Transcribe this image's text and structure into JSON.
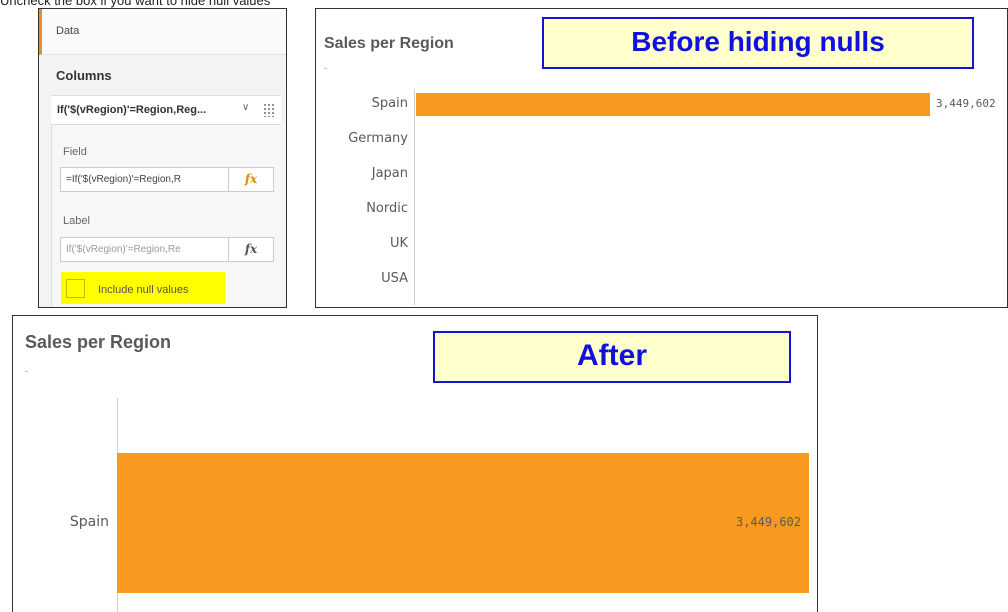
{
  "caption": "Uncheck the box if you want to hide null values",
  "panel": {
    "data_tab": "Data",
    "columns_title": "Columns",
    "column_item_label": "If('$(vRegion)'=Region,Reg...",
    "field_label": "Field",
    "field_value": "=If('$(vRegion)'=Region,R",
    "label_label": "Label",
    "label_placeholder": "If('$(vRegion)'=Region,Re",
    "fx_label": "fx",
    "include_null_label": "Include null values",
    "include_null_checked": false,
    "highlight_color": "#ffff00"
  },
  "before_chart": {
    "annotation": "Before hiding nulls",
    "subtitle": "-"
  },
  "after_chart": {
    "annotation": "After",
    "subtitle": "-"
  },
  "chart_data": [
    {
      "type": "bar",
      "orientation": "horizontal",
      "title": "Sales per Region",
      "categories": [
        "Spain",
        "Germany",
        "Japan",
        "Nordic",
        "UK",
        "USA"
      ],
      "values": [
        3449602,
        0,
        0,
        0,
        0,
        0
      ],
      "value_labels": [
        "3,449,602",
        "",
        "",
        "",
        "",
        ""
      ],
      "xlim": [
        0,
        3449602
      ],
      "bar_color": "#f89a1f",
      "grid": false
    },
    {
      "type": "bar",
      "orientation": "horizontal",
      "title": "Sales per Region",
      "categories": [
        "Spain"
      ],
      "values": [
        3449602
      ],
      "value_labels": [
        "3,449,602"
      ],
      "xlim": [
        0,
        3449602
      ],
      "bar_color": "#f89a1f",
      "grid": false
    }
  ]
}
